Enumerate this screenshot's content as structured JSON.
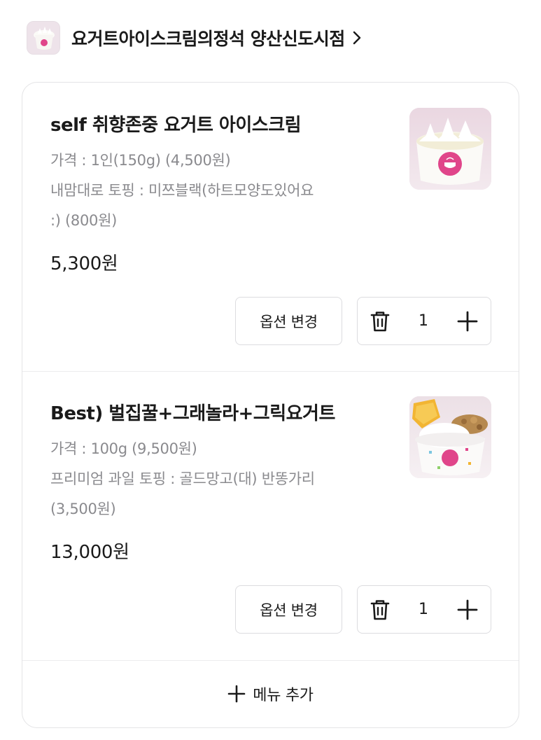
{
  "store": {
    "name": "요거트아이스크림의정석 양산신도시점",
    "logo_icon": "store-logo-image",
    "chevron_icon": "chevron-right-icon"
  },
  "items": [
    {
      "name": "self 취향존중 요거트 아이스크림",
      "options": [
        "가격 : 1인(150g) (4,500원)",
        "내맘대로 토핑 : 미쯔블랙(하트모양도있어요",
        ":) (800원)"
      ],
      "price": "5,300원",
      "option_button": "옵션 변경",
      "quantity": "1",
      "thumb_icon": "yogurt-cup-image"
    },
    {
      "name": "Best) 벌집꿀+그래놀라+그릭요거트",
      "options": [
        "가격 : 100g (9,500원)",
        "프리미엄 과일 토핑 : 골드망고(대) 반똥가리",
        "(3,500원)"
      ],
      "price": "13,000원",
      "option_button": "옵션 변경",
      "quantity": "1",
      "thumb_icon": "honeycomb-granola-yogurt-image"
    }
  ],
  "add_menu": {
    "label": "메뉴 추가",
    "icon": "plus-icon"
  },
  "colors": {
    "text": "#1a1a1a",
    "muted": "#8a8a8e",
    "border": "#dcdcdf",
    "card_border": "#e4e4e6",
    "brand_pink": "#e0458a"
  }
}
